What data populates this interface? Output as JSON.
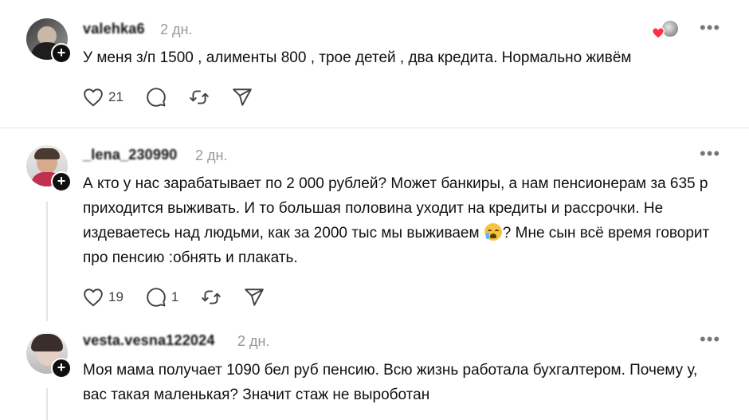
{
  "posts": [
    {
      "username": "valehka6",
      "time": "2 дн.",
      "text": "У меня з/п 1500 , алименты 800 , трое детей , два кредита. Нормально живём",
      "text_after_emoji": "",
      "likes": "21",
      "replies": "",
      "icons": {
        "like": "heart-icon",
        "reply": "comment-icon",
        "repost": "repost-icon",
        "share": "send-icon"
      }
    },
    {
      "username": "_lena_230990",
      "time": "2 дн.",
      "text": "А кто у нас зарабатывает по 2 000 рублей? Может банкиры, а нам пенсионерам за 635 р приходится выживать. И то большая половина уходит на кредиты и рассрочки. Не издеваетесь над людьми, как за 2000 тыс мы выживаем ",
      "text_after_emoji": "? Мне сын всё время говорит про пенсию :обнять и плакать.",
      "likes": "19",
      "replies": "1"
    },
    {
      "username": "vesta.vesna122024",
      "time": "2 дн.",
      "text": "Моя мама получает 1090 бел руб пенсию. Всю жизнь работала бухгалтером. Почему у, вас такая маленькая? Значит стаж не выроботан"
    }
  ],
  "more_label": "•••",
  "plus_label": "+",
  "colors": {
    "text": "#101010",
    "muted": "#999999",
    "heart": "#ff3040"
  }
}
